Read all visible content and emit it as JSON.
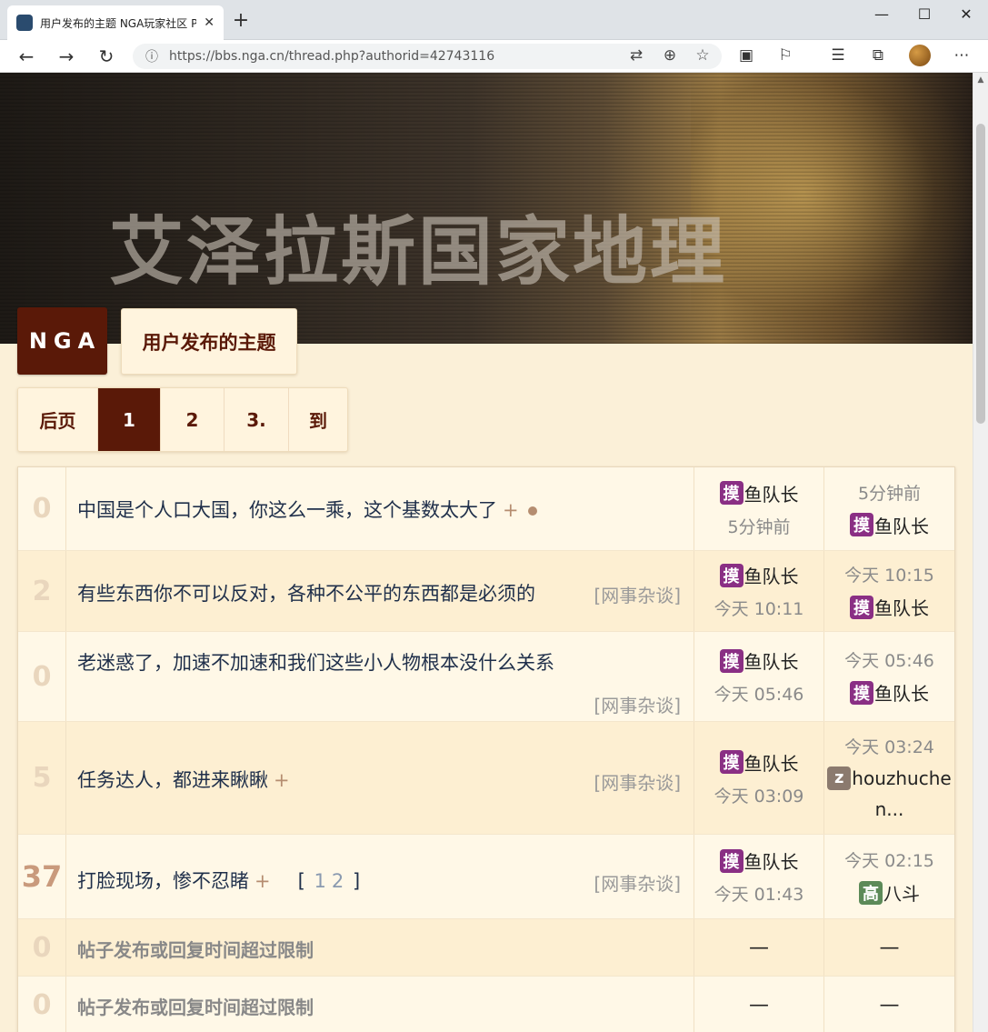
{
  "browser": {
    "tab_title": "用户发布的主题 NGA玩家社区 P",
    "url_host": "https://bbs.nga.cn",
    "url_path": "/thread.php?authorid=42743116"
  },
  "banner": {
    "title": "艾泽拉斯国家地理"
  },
  "logo": "NGA",
  "page_title": "用户发布的主题",
  "pager": {
    "prev": "后页",
    "p1": "1",
    "p2": "2",
    "p3": "3.",
    "goto": "到"
  },
  "topics": [
    {
      "replies": "0",
      "title": "中国是个人口大国，你这么一乘，这个基数太大了",
      "plus": "+",
      "tag": "",
      "author": "鱼队长",
      "author_avatar": "摸",
      "post_time": "5分钟前",
      "last_time": "5分钟前",
      "last_user": "鱼队长",
      "last_avatar": "摸"
    },
    {
      "replies": "2",
      "title": "有些东西你不可以反对，各种不公平的东西都是必须的",
      "tag": "[网事杂谈]",
      "author": "鱼队长",
      "author_avatar": "摸",
      "post_time": "今天 10:11",
      "last_time": "今天 10:15",
      "last_user": "鱼队长",
      "last_avatar": "摸"
    },
    {
      "replies": "0",
      "title": "老迷惑了，加速不加速和我们这些小人物根本没什么关系",
      "tag": "[网事杂谈]",
      "author": "鱼队长",
      "author_avatar": "摸",
      "post_time": "今天 05:46",
      "last_time": "今天 05:46",
      "last_user": "鱼队长",
      "last_avatar": "摸"
    },
    {
      "replies": "5",
      "title": "任务达人，都进来瞅瞅",
      "plus": "+",
      "tag": "[网事杂谈]",
      "author": "鱼队长",
      "author_avatar": "摸",
      "post_time": "今天 03:09",
      "last_time": "今天 03:24",
      "last_user_line1": "houzhuche",
      "last_user_line2": "n...",
      "last_avatar": "z"
    },
    {
      "replies": "37",
      "title": "打脸现场，惨不忍睹",
      "plus": "+",
      "page_open": "[",
      "page_1": "1",
      "page_2": "2",
      "page_close": "]",
      "tag": "[网事杂谈]",
      "author": "鱼队长",
      "author_avatar": "摸",
      "post_time": "今天 01:43",
      "last_time": "今天 02:15",
      "last_user": "八斗",
      "last_avatar": "高"
    },
    {
      "replies": "0",
      "system": "帖子发布或回复时间超过限制",
      "author_dash": "—",
      "last_dash": "—"
    },
    {
      "replies": "0",
      "system": "帖子发布或回复时间超过限制",
      "author_dash": "—",
      "last_dash": "—"
    }
  ]
}
